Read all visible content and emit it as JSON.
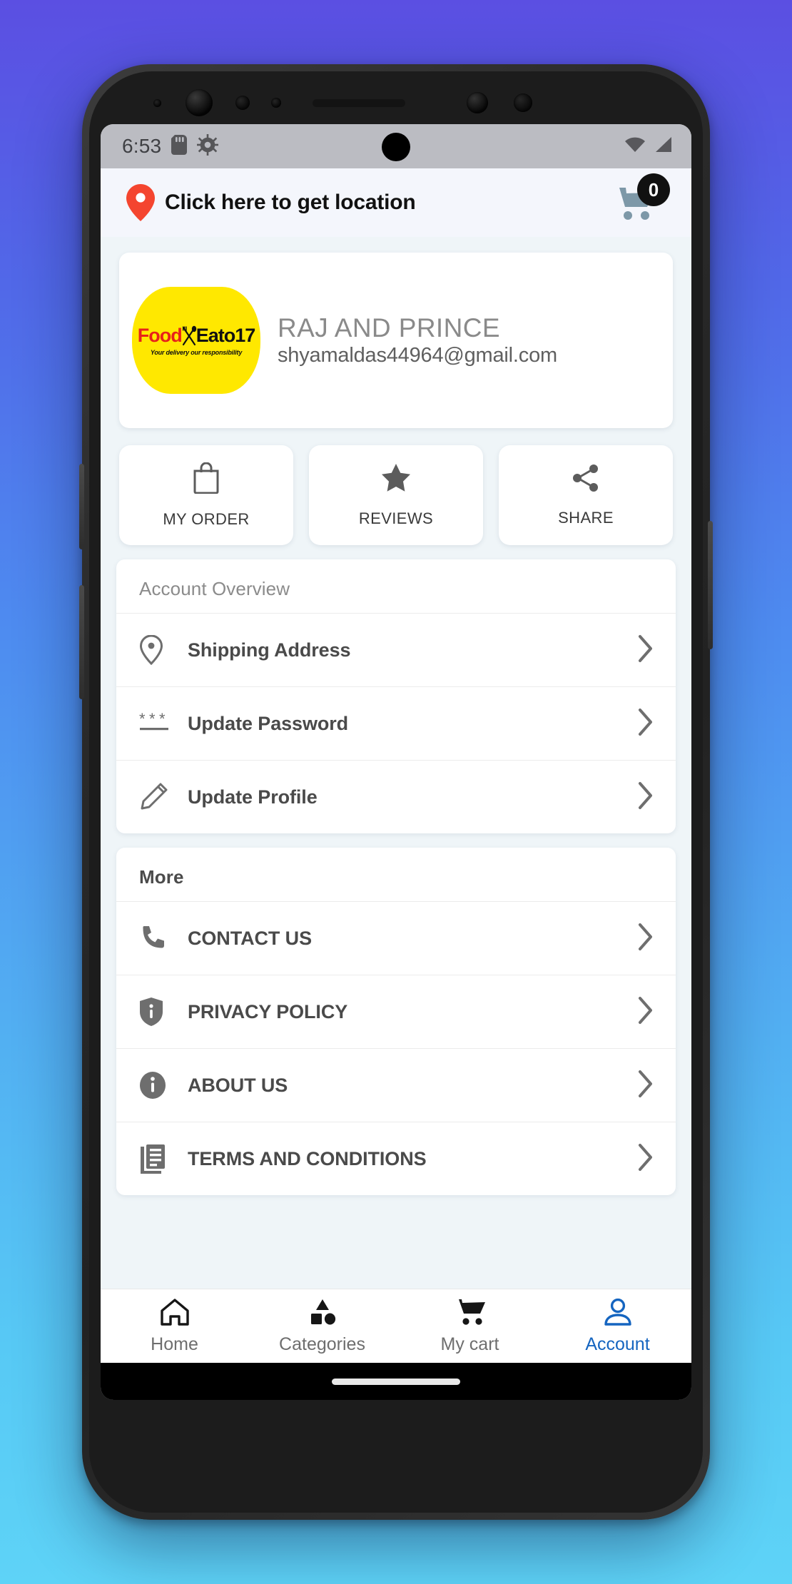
{
  "status_bar": {
    "time": "6:53",
    "icons": [
      "sd-card-icon",
      "gear-icon"
    ],
    "right_icons": [
      "wifi-icon",
      "signal-icon"
    ]
  },
  "header": {
    "location_label": "Click here to get location",
    "location_icon": "map-pin-icon",
    "cart_icon": "shopping-cart-icon",
    "cart_count": "0"
  },
  "profile": {
    "logo": {
      "brand_first": "Food",
      "brand_second": "Eato17",
      "tagline": "Your delivery our responsibility",
      "bg_color": "#FFE800",
      "first_color": "#E8211A",
      "second_color": "#111111"
    },
    "name": "RAJ AND PRINCE",
    "email": "shyamaldas44964@gmail.com"
  },
  "actions": [
    {
      "label": "MY ORDER",
      "icon": "shopping-bag-icon"
    },
    {
      "label": "REVIEWS",
      "icon": "star-icon"
    },
    {
      "label": "SHARE",
      "icon": "share-icon"
    }
  ],
  "account_overview": {
    "title": "Account Overview",
    "items": [
      {
        "label": "Shipping Address",
        "icon": "map-pin-outline-icon"
      },
      {
        "label": "Update Password",
        "icon": "asterisks-icon"
      },
      {
        "label": "Update Profile",
        "icon": "pencil-icon"
      }
    ]
  },
  "more": {
    "title": "More",
    "items": [
      {
        "label": "CONTACT US",
        "icon": "phone-icon"
      },
      {
        "label": "PRIVACY POLICY",
        "icon": "shield-info-icon"
      },
      {
        "label": "ABOUT US",
        "icon": "info-circle-icon"
      },
      {
        "label": "TERMS AND CONDITIONS",
        "icon": "document-article-icon"
      }
    ]
  },
  "bottom_nav": {
    "active_color": "#1565C0",
    "items": [
      {
        "label": "Home",
        "icon": "home-icon",
        "active": false
      },
      {
        "label": "Categories",
        "icon": "categories-shapes-icon",
        "active": false
      },
      {
        "label": "My cart",
        "icon": "cart-icon",
        "active": false
      },
      {
        "label": "Account",
        "icon": "person-icon",
        "active": true
      }
    ]
  },
  "theme": {
    "background_gradient_top": "#5B4FE2",
    "background_gradient_bottom": "#5ED3F7",
    "app_background": "#EFF5F8",
    "card_background": "#FFFFFF",
    "accent_blue": "#1565C0",
    "pin_red": "#F4452F",
    "cart_slate": "#7D98A8"
  }
}
